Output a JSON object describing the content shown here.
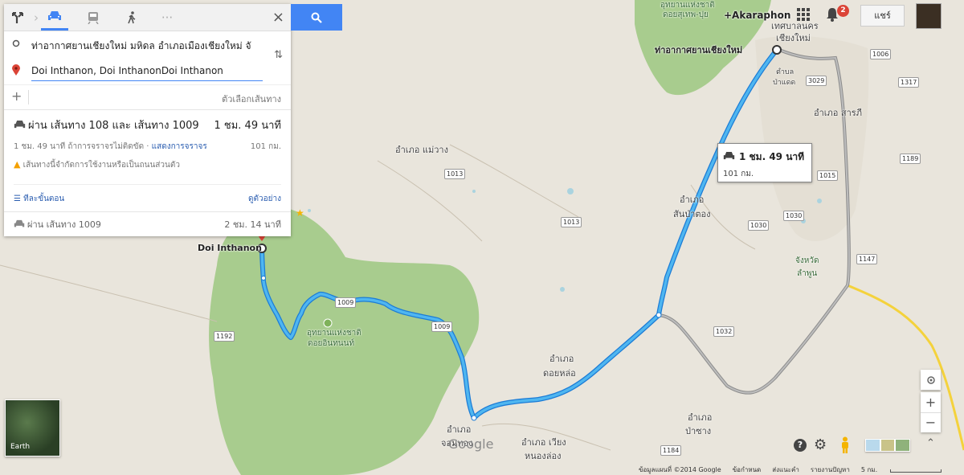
{
  "panel": {
    "origin": "ท่าอากาศยานเชียงใหม่ มหิดล อำเภอเมืองเชียงใหม่ จั",
    "destination": "Doi Inthanon, Doi InthanonDoi Inthanon",
    "options_label": "ตัวเลือกเส้นทาง",
    "route1": {
      "title": "ผ่าน เส้นทาง 108 และ เส้นทาง 1009",
      "duration": "1 ชม. 49 นาที",
      "subtitle_prefix": "1 ชม. 49 นาที ถ้าการจราจรไม่ติดขัด · ",
      "traffic_link": "แสดงการจราจร",
      "distance": "101 กม.",
      "warning": "เส้นทางนี้จำกัดการใช้งานหรือเป็นถนนส่วนตัว",
      "steps_label": "ทีละขั้นตอน",
      "preview_label": "ดูตัวอย่าง"
    },
    "route2": {
      "title": "ผ่าน เส้นทาง 1009",
      "duration": "2 ชม. 14 นาที"
    }
  },
  "callout": {
    "duration": "1 ชม. 49 นาที",
    "distance": "101 กม."
  },
  "header": {
    "user_place": "+Akaraphon",
    "notif_count": "2",
    "share_label": "แชร์"
  },
  "map_labels": {
    "airport": "ท่าอากาศยานเชียงใหม่",
    "doi_inthanon": "Doi Inthanon",
    "mae_wang": "อำเภอ แม่วาง",
    "san_pa_tong_1": "อำเภอ",
    "san_pa_tong_2": "สันป่าตอง",
    "saraphi": "อำเภอ สารภี",
    "lamphun_1": "จังหวัด",
    "lamphun_2": "ลำพูน",
    "doi_lo_1": "อำเภอ",
    "doi_lo_2": "ดอยหล่อ",
    "chom_thong_1": "อำเภอ",
    "chom_thong_2": "จอมทอง",
    "wiang_1": "อำเภอ เวียง",
    "wiang_2": "หนองล่อง",
    "pa_sang_1": "อำเภอ",
    "pa_sang_2": "ป่าซาง",
    "park_1": "อุทยานแห่งชาติ",
    "park_2": "ดอยอินทนนท์",
    "city_1": "เทศบาลนคร",
    "city_2": "เชียงใหม่",
    "tambon_1": "ตำบล",
    "tambon_2": "ป่าแดด",
    "suthep_1": "อุทยานแห่งชาติ",
    "suthep_2": "ดอยสุเทพ-ปุย",
    "google": "Google"
  },
  "shields": [
    "1013",
    "1013",
    "1009",
    "1009",
    "1192",
    "1030",
    "1030",
    "1032",
    "1147",
    "1189",
    "1006",
    "1317",
    "3029",
    "1184",
    "1015"
  ],
  "earth_label": "Earth",
  "footer": [
    "ข้อมูลแผนที่ ©2014 Google",
    "ข้อกำหนด",
    "ส่งแนะคำ",
    "รายงานปัญหา",
    "5 กม."
  ],
  "colors": {
    "route": "#4fb6f0",
    "route_outline": "#1c7cd6",
    "accent": "#4285f4",
    "forest": "#9fc48a",
    "alt_route": "#8c8c8c"
  },
  "icons": [
    "directions-icon",
    "car-icon",
    "transit-icon",
    "walk-icon",
    "more-icon",
    "close-icon",
    "search-icon",
    "swap-icon",
    "apps-icon",
    "bell-icon",
    "locate-icon",
    "zoom-in-icon",
    "zoom-out-icon",
    "help-icon",
    "settings-icon",
    "pegman-icon",
    "expand-icon"
  ]
}
